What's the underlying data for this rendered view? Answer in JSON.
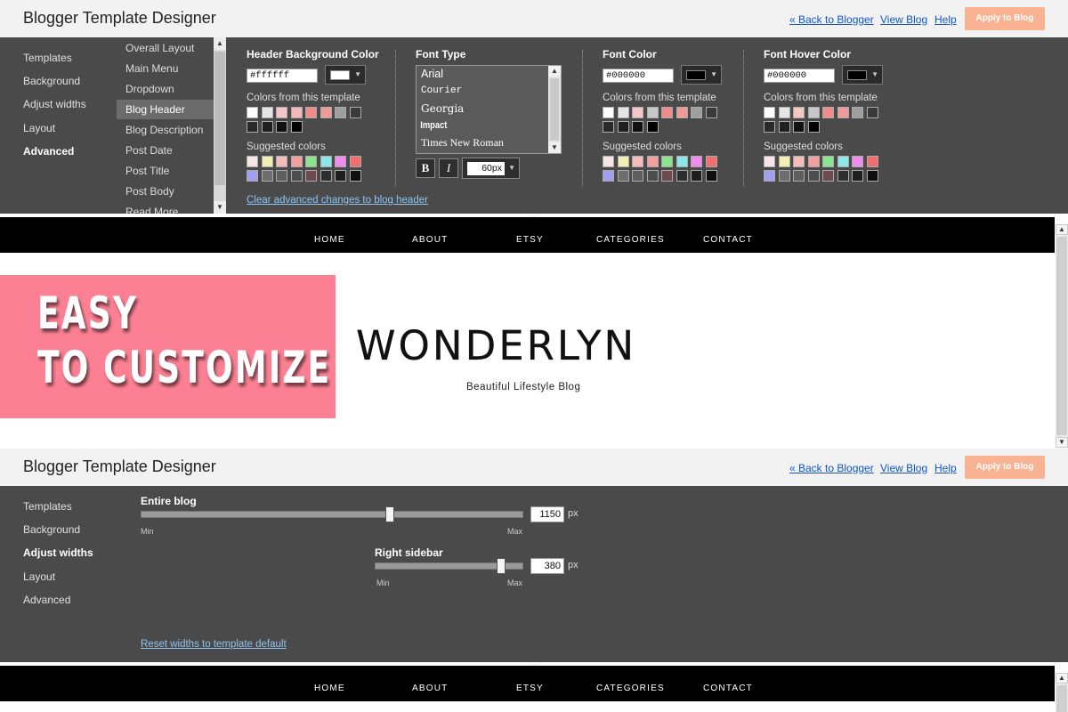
{
  "designer_top": {
    "title": "Blogger Template Designer",
    "links": {
      "back": "« Back to Blogger",
      "view": "View Blog",
      "help": "Help"
    },
    "apply_button": "Apply to Blog",
    "nav": [
      "Templates",
      "Background",
      "Adjust widths",
      "Layout",
      "Advanced"
    ],
    "nav_active": "Advanced",
    "subnav": [
      "Overall Layout",
      "Main Menu",
      "Dropdown",
      "Blog Header",
      "Blog Description",
      "Post Date",
      "Post Title",
      "Post Body",
      "Read More"
    ],
    "subnav_active": "Blog Header",
    "header_bg": {
      "title": "Header Background Color",
      "hex": "#ffffff",
      "swatch": "#ffffff",
      "template_label": "Colors from this template",
      "suggested_label": "Suggested colors",
      "template_colors": [
        "#ffffff",
        "#e6e6e6",
        "#f5c6c6",
        "#f5b8b8",
        "#f08c8c",
        "#f09a9a",
        "#9e9e9e",
        "#3a3a3a",
        "#2a2a2a",
        "#1f1f1f",
        "#111111",
        "#000000"
      ],
      "suggested_colors": [
        "#f8e6e6",
        "#f2f0b0",
        "#f5bcbc",
        "#f4a0a0",
        "#8de38d",
        "#8ce8e8",
        "#f08cf0",
        "#f06e6e",
        "#a0a0f0",
        "#6e6e6e",
        "#5e5e5e",
        "#4e4e4e",
        "#6e4a4a",
        "#2e2e2e",
        "#1e1e1e",
        "#0e0e0e"
      ]
    },
    "font_type": {
      "title": "Font Type",
      "options": [
        "Arial",
        "Courier",
        "Georgia",
        "Impact",
        "Times New Roman"
      ],
      "selected": "Arial",
      "bold_label": "B",
      "italic_label": "I",
      "size": "60px"
    },
    "font_color": {
      "title": "Font Color",
      "hex": "#000000",
      "swatch": "#000000",
      "template_label": "Colors from this template",
      "suggested_label": "Suggested colors",
      "template_colors": [
        "#ffffff",
        "#e6e6e6",
        "#f5c6c6",
        "#c8c8c8",
        "#f08c8c",
        "#f09a9a",
        "#9e9e9e",
        "#3a3a3a",
        "#2a2a2a",
        "#1f1f1f",
        "#111111",
        "#000000"
      ],
      "suggested_colors": [
        "#f8e6e6",
        "#f2f0b0",
        "#f5bcbc",
        "#f4a0a0",
        "#8de38d",
        "#8ce8e8",
        "#f08cf0",
        "#f06e6e",
        "#a0a0f0",
        "#6e6e6e",
        "#5e5e5e",
        "#4e4e4e",
        "#6e4a4a",
        "#2e2e2e",
        "#1e1e1e",
        "#0e0e0e"
      ]
    },
    "font_hover": {
      "title": "Font Hover Color",
      "hex": "#000000",
      "swatch": "#000000",
      "template_label": "Colors from this template",
      "suggested_label": "Suggested colors",
      "template_colors": [
        "#ffffff",
        "#e6e6e6",
        "#f5c6c6",
        "#c8c8c8",
        "#f08c8c",
        "#f09a9a",
        "#9e9e9e",
        "#3a3a3a",
        "#2a2a2a",
        "#1f1f1f",
        "#111111",
        "#000000"
      ],
      "suggested_colors": [
        "#f8e6e6",
        "#f2f0b0",
        "#f5bcbc",
        "#f4a0a0",
        "#8de38d",
        "#8ce8e8",
        "#f08cf0",
        "#f06e6e",
        "#a0a0f0",
        "#6e6e6e",
        "#5e5e5e",
        "#4e4e4e",
        "#6e4a4a",
        "#2e2e2e",
        "#1e1e1e",
        "#0e0e0e"
      ]
    },
    "clear_link": "Clear advanced changes to blog header"
  },
  "blog_preview": {
    "nav": [
      "HOME",
      "ABOUT",
      "ETSY",
      "CATEGORIES",
      "CONTACT"
    ],
    "promo_lines": [
      "EASY",
      "TO CUSTOMIZE"
    ],
    "blog_title": "WONDERLYN",
    "tagline": "Beautiful Lifestyle Blog"
  },
  "designer_bottom": {
    "title": "Blogger Template Designer",
    "links": {
      "back": "« Back to Blogger",
      "view": "View Blog",
      "help": "Help"
    },
    "apply_button": "Apply to Blog",
    "nav": [
      "Templates",
      "Background",
      "Adjust widths",
      "Layout",
      "Advanced"
    ],
    "nav_active": "Adjust widths",
    "entire_blog": {
      "title": "Entire blog",
      "value": "1150",
      "unit": "px",
      "min_label": "Min",
      "max_label": "Max",
      "level": 0.65
    },
    "right_sidebar": {
      "title": "Right sidebar",
      "value": "380",
      "unit": "px",
      "min_label": "Min",
      "max_label": "Max",
      "level": 0.85
    },
    "reset_link": "Reset widths to template default"
  },
  "blog_preview_bottom": {
    "nav": [
      "HOME",
      "ABOUT",
      "ETSY",
      "CATEGORIES",
      "CONTACT"
    ]
  }
}
